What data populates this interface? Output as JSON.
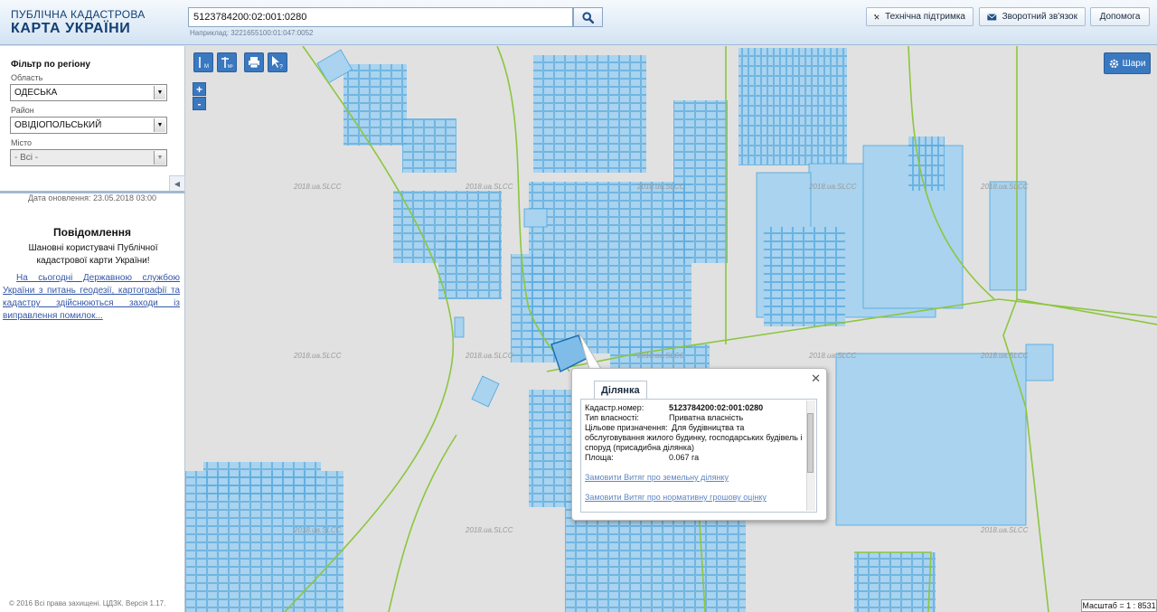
{
  "header": {
    "logo_line1": "ПУБЛІЧНА КАДАСТРОВА",
    "logo_line2": "КАРТА УКРАЇНИ",
    "search_value": "5123784200:02:001:0280",
    "example": "Наприклад: 3221655100:01:047:0052",
    "support_label": "Технічна підтримка",
    "feedback_label": "Зворотний зв'язок",
    "help_label": "Допомога"
  },
  "sidebar": {
    "filter_title": "Фільтр по регіону",
    "oblast_label": "Область",
    "oblast_value": "ОДЕСЬКА",
    "rayon_label": "Район",
    "rayon_value": "ОВІДІОПОЛЬСЬКИЙ",
    "city_label": "Місто",
    "city_value": "- Всі -",
    "update_date": "Дата оновлення: 23.05.2018 03:00",
    "news_title": "Повідомлення",
    "news_text": "Шановні користувачі Публічної кадастрової карти України!",
    "news_link": "На сьогодні Державною службою України з питань геодезії, картографії та кадастру здійснюються заходи із виправлення помилок...",
    "copyright": "© 2016 Всі права захищені. ЦДЗК. Версія 1.17."
  },
  "map": {
    "layers_label": "Шари",
    "scale": "Масштаб = 1 : 8531",
    "watermark": "2018.ua.SLCC",
    "colors": {
      "parcel_fill": "#a9d3ee",
      "parcel_stroke": "#4da6e0",
      "boundary": "#8cc63f",
      "background": "#e1e1e1"
    }
  },
  "popup": {
    "tab": "Ділянка",
    "rows": [
      {
        "label": "Кадастр.номер:",
        "value": "5123784200:02:001:0280"
      },
      {
        "label": "Тип власності:",
        "value": "Приватна власність"
      },
      {
        "label": "Цільове призначення:",
        "value": "Для будівництва та"
      },
      {
        "label": "",
        "value": "обслуговування жилого будинку, господарських будівель і"
      },
      {
        "label": "",
        "value": "споруд (присадибна ділянка)"
      },
      {
        "label": "Площа:",
        "value": "0.067 га"
      }
    ],
    "link1": "Замовити Витяг про земельну ділянку",
    "link2": "Замовити Витяг про нормативну грошову оцінку"
  }
}
